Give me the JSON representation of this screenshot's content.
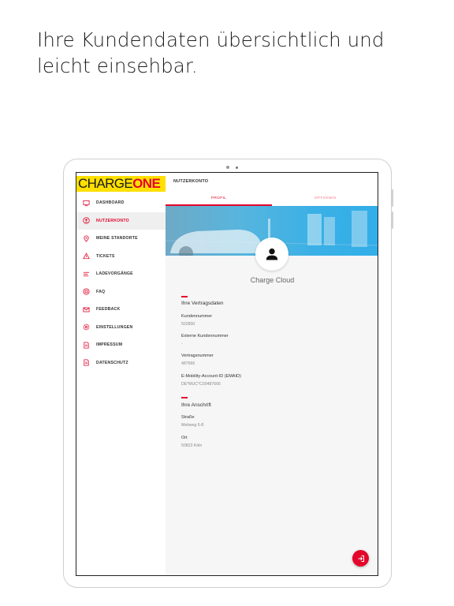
{
  "headline": "Ihre Kundendaten übersichtlich und leicht einsehbar.",
  "colors": {
    "accent": "#e3062b",
    "logo_bg": "#ffe000",
    "banner": "#3ab0e6"
  },
  "logo": {
    "part1": "CHARGE",
    "part2": "ONE"
  },
  "sidebar": {
    "items": [
      {
        "label": "DASHBOARD",
        "icon": "monitor-icon"
      },
      {
        "label": "NUTZERKONTO",
        "icon": "user-circle-icon",
        "active": true
      },
      {
        "label": "MEINE STANDORTE",
        "icon": "map-pin-icon"
      },
      {
        "label": "TICKETS",
        "icon": "warning-icon"
      },
      {
        "label": "LADEVORGÄNGE",
        "icon": "list-icon"
      },
      {
        "label": "FAQ",
        "icon": "help-icon"
      },
      {
        "label": "FEEDBACK",
        "icon": "mail-icon"
      },
      {
        "label": "EINSTELLUNGEN",
        "icon": "gear-icon"
      },
      {
        "label": "IMPRESSUM",
        "icon": "document-icon"
      },
      {
        "label": "DATENSCHUTZ",
        "icon": "document-icon"
      }
    ]
  },
  "header": {
    "title": "NUTZERKONTO"
  },
  "tabs": [
    {
      "label": "PROFIL"
    },
    {
      "label": "OPTIONEN"
    }
  ],
  "profile": {
    "name": "Charge Cloud",
    "contract_section": "Ihre Vertragsdaten",
    "address_section": "Ihre Anschrift",
    "fields": [
      {
        "label": "Kundennummer",
        "value": "502800"
      },
      {
        "label": "Externe Kundennummer",
        "value": "-"
      },
      {
        "label": "Vertragsnummer",
        "value": "487666"
      },
      {
        "label": "E-Mobility-Account-ID (EMAID)",
        "value": "DE*MUC*C00487666"
      }
    ],
    "address": [
      {
        "label": "Straße",
        "value": "Meitweg 6-8"
      },
      {
        "label": "Ort",
        "value": "50823 Köln"
      }
    ]
  },
  "fab": {
    "icon": "logout-icon"
  }
}
